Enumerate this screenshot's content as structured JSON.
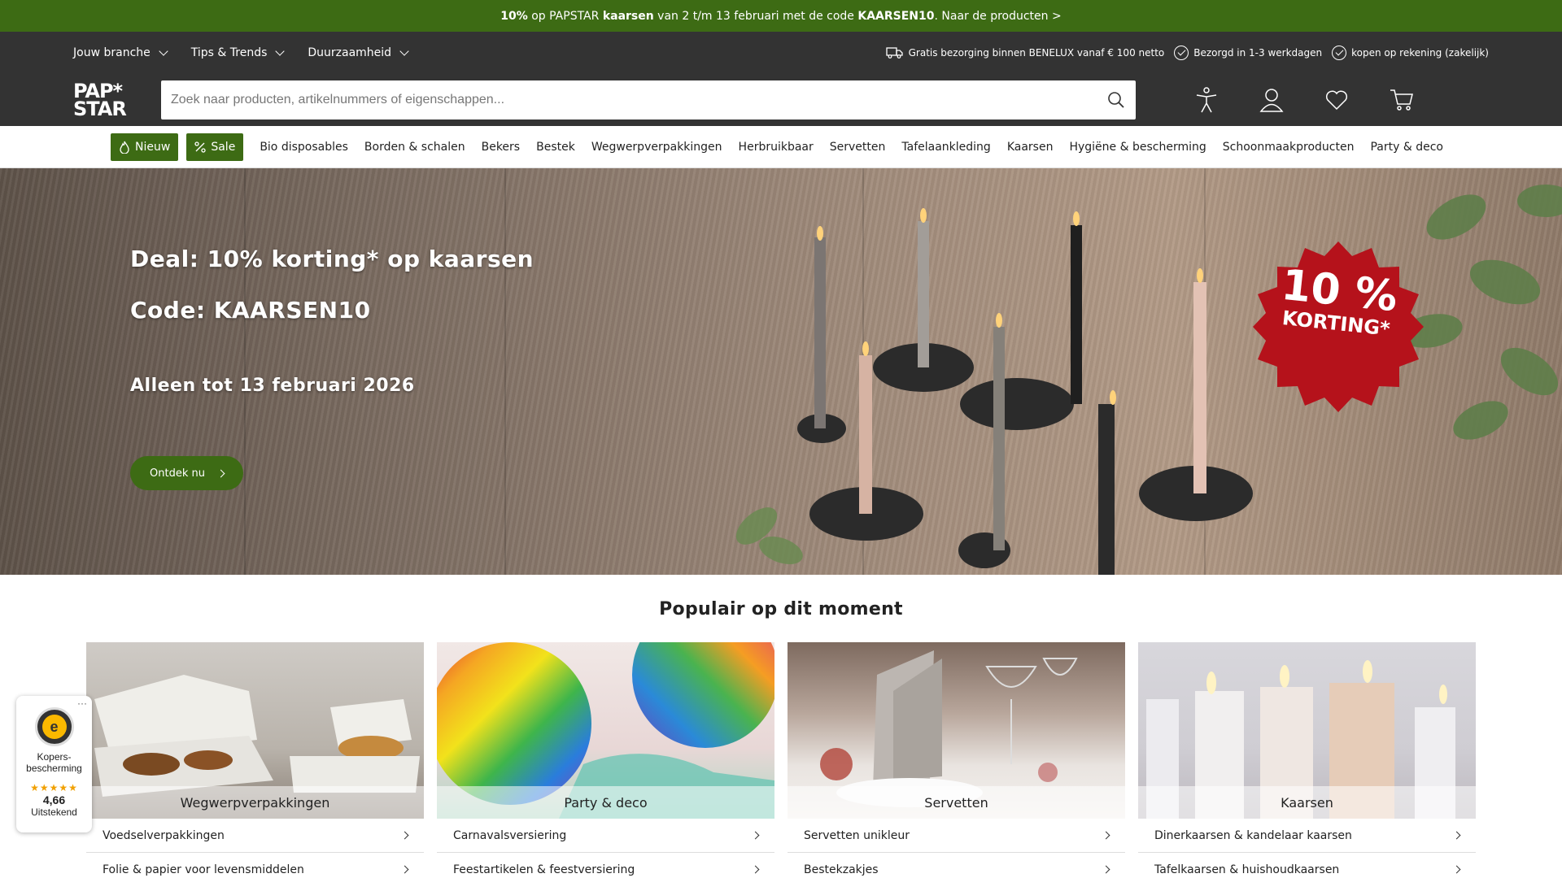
{
  "promo": {
    "pct": "10%",
    "t1": " op PAPSTAR ",
    "product": "kaarsen",
    "t2": " van 2 t/m 13 februari met de code ",
    "code": "KAARSEN10",
    "t3": ". Naar de producten >"
  },
  "topnav": [
    "Jouw branche",
    "Tips & Trends",
    "Duurzaamheid"
  ],
  "usp": [
    "Gratis bezorging binnen BENELUX vanaf € 100 netto",
    "Bezorgd in 1-3 werkdagen",
    "kopen op rekening (zakelijk)"
  ],
  "header": {
    "logo_line1": "PAP*",
    "logo_line2": "STAR",
    "search_placeholder": "Zoek naar producten, artikelnummers of eigenschappen..."
  },
  "catnav": {
    "new": "Nieuw",
    "sale": "Sale",
    "items": [
      "Bio disposables",
      "Borden & schalen",
      "Bekers",
      "Bestek",
      "Wegwerpverpakkingen",
      "Herbruikbaar",
      "Servetten",
      "Tafelaankleding",
      "Kaarsen",
      "Hygiëne & bescherming",
      "Schoonmaakproducten",
      "Party & deco"
    ]
  },
  "hero": {
    "line1": "Deal: 10% korting* op kaarsen",
    "line2": "Code: KAARSEN10",
    "line3": "Alleen tot 13 februari 2026",
    "cta": "Ontdek nu",
    "badge_big": "10 %",
    "badge_small": "KORTING*"
  },
  "popular": {
    "title": "Populair op dit moment",
    "cards": [
      {
        "label": "Wegwerpverpakkingen",
        "rows": [
          "Voedselverpakkingen",
          "Folie & papier voor levensmiddelen"
        ]
      },
      {
        "label": "Party & deco",
        "rows": [
          "Carnavalsversiering",
          "Feestartikelen & feestversiering"
        ]
      },
      {
        "label": "Servetten",
        "rows": [
          "Servetten unikleur",
          "Bestekzakjes"
        ]
      },
      {
        "label": "Kaarsen",
        "rows": [
          "Dinerkaarsen & kandelaar kaarsen",
          "Tafelkaarsen & huishoudkaarsen"
        ]
      }
    ]
  },
  "trust": {
    "seal": "e",
    "line1": "Kopers-",
    "line2": "bescherming",
    "stars": "★★★★★",
    "score": "4,66",
    "rating": "Uitstekend",
    "dots": "···"
  },
  "colors": {
    "brand_green": "#3d6b14",
    "header_dark": "#333333",
    "badge_red": "#b5121b"
  }
}
